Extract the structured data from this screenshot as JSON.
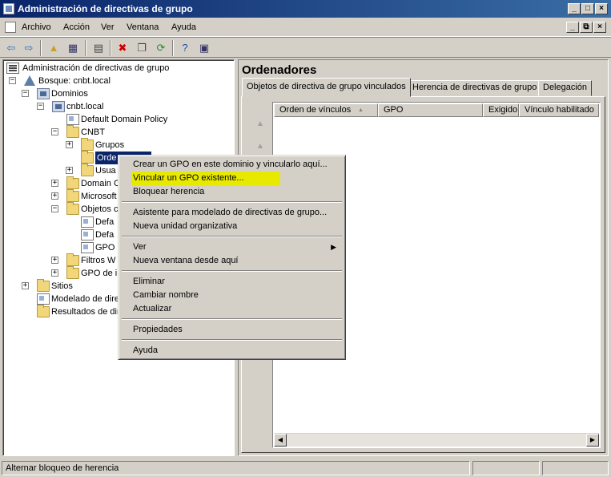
{
  "window": {
    "title": "Administración de directivas de grupo",
    "minimize": "_",
    "maximize": "□",
    "close": "×"
  },
  "menubar": {
    "items": [
      "Archivo",
      "Acción",
      "Ver",
      "Ventana",
      "Ayuda"
    ],
    "mdi": {
      "minimize": "_",
      "restore": "⧉",
      "close": "×"
    }
  },
  "toolbar": {
    "buttons": [
      {
        "name": "back-icon",
        "glyph": "⇦",
        "color": "#2a6fbf"
      },
      {
        "name": "forward-icon",
        "glyph": "⇨",
        "color": "#2a6fbf"
      },
      {
        "name": "up-folder-icon",
        "glyph": "▲",
        "color": "#c8a030"
      },
      {
        "name": "show-hide-tree-icon",
        "glyph": "▦",
        "color": "#336"
      },
      {
        "name": "properties-icon",
        "glyph": "▤",
        "color": "#444"
      },
      {
        "name": "delete-icon",
        "glyph": "✖",
        "color": "#d00000"
      },
      {
        "name": "copy-icon",
        "glyph": "❐",
        "color": "#444"
      },
      {
        "name": "refresh-icon",
        "glyph": "⟳",
        "color": "#2a8a2a"
      },
      {
        "name": "help-icon",
        "glyph": "?",
        "color": "#1a4db3"
      },
      {
        "name": "mmc-icon",
        "glyph": "▣",
        "color": "#336"
      }
    ]
  },
  "tree": {
    "root": "Administración de directivas de grupo",
    "forest": "Bosque: cnbt.local",
    "domains": "Dominios",
    "domain": "cnbt.local",
    "default_policy": "Default Domain Policy",
    "cnbt": "CNBT",
    "grupos": "Grupos",
    "ordenadores_visible": "Orde",
    "usuarios_visible": "Usua",
    "domain_controllers_visible": "Domain C",
    "microsoft_visible": "Microsoft",
    "objetos_visible": "Objetos c",
    "gpo1_visible": "Defa",
    "gpo2_visible": "Defa",
    "gpo3_visible": "GPO",
    "filtros_visible": "Filtros W",
    "gpo_de_visible": "GPO de ir",
    "sitios": "Sitios",
    "modelado_visible": "Modelado de dire",
    "resultados_visible": "Resultados de dir",
    "expander_plus": "+",
    "expander_minus": "−"
  },
  "right": {
    "heading": "Ordenadores",
    "tabs": [
      "Objetos de directiva de grupo vinculados",
      "Herencia de directivas de grupo",
      "Delegación"
    ],
    "columns": [
      "Orden de vínculos",
      "GPO",
      "Exigido",
      "Vínculo habilitado"
    ],
    "sort_indicator": "▲",
    "up_arrow": "▲",
    "scroll_left": "◀",
    "scroll_right": "▶"
  },
  "context_menu": {
    "items": [
      "Crear un GPO en este dominio y vincularlo aquí...",
      "Vincular un GPO existente...",
      "Bloquear herencia",
      "Asistente para modelado de directivas de grupo...",
      "Nueva unidad organizativa",
      "Ver",
      "Nueva ventana desde aquí",
      "Eliminar",
      "Cambiar nombre",
      "Actualizar",
      "Propiedades",
      "Ayuda"
    ],
    "submenu_arrow": "▶",
    "highlight_color": "#e7ea00"
  },
  "statusbar": {
    "text": "Alternar bloqueo de herencia"
  }
}
